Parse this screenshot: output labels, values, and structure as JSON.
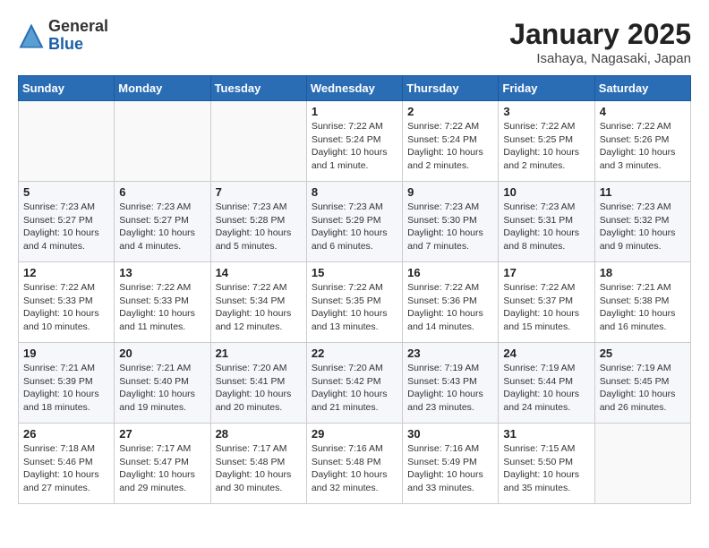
{
  "header": {
    "logo_general": "General",
    "logo_blue": "Blue",
    "month_title": "January 2025",
    "location": "Isahaya, Nagasaki, Japan"
  },
  "weekdays": [
    "Sunday",
    "Monday",
    "Tuesday",
    "Wednesday",
    "Thursday",
    "Friday",
    "Saturday"
  ],
  "weeks": [
    [
      {
        "day": "",
        "info": ""
      },
      {
        "day": "",
        "info": ""
      },
      {
        "day": "",
        "info": ""
      },
      {
        "day": "1",
        "info": "Sunrise: 7:22 AM\nSunset: 5:24 PM\nDaylight: 10 hours\nand 1 minute."
      },
      {
        "day": "2",
        "info": "Sunrise: 7:22 AM\nSunset: 5:24 PM\nDaylight: 10 hours\nand 2 minutes."
      },
      {
        "day": "3",
        "info": "Sunrise: 7:22 AM\nSunset: 5:25 PM\nDaylight: 10 hours\nand 2 minutes."
      },
      {
        "day": "4",
        "info": "Sunrise: 7:22 AM\nSunset: 5:26 PM\nDaylight: 10 hours\nand 3 minutes."
      }
    ],
    [
      {
        "day": "5",
        "info": "Sunrise: 7:23 AM\nSunset: 5:27 PM\nDaylight: 10 hours\nand 4 minutes."
      },
      {
        "day": "6",
        "info": "Sunrise: 7:23 AM\nSunset: 5:27 PM\nDaylight: 10 hours\nand 4 minutes."
      },
      {
        "day": "7",
        "info": "Sunrise: 7:23 AM\nSunset: 5:28 PM\nDaylight: 10 hours\nand 5 minutes."
      },
      {
        "day": "8",
        "info": "Sunrise: 7:23 AM\nSunset: 5:29 PM\nDaylight: 10 hours\nand 6 minutes."
      },
      {
        "day": "9",
        "info": "Sunrise: 7:23 AM\nSunset: 5:30 PM\nDaylight: 10 hours\nand 7 minutes."
      },
      {
        "day": "10",
        "info": "Sunrise: 7:23 AM\nSunset: 5:31 PM\nDaylight: 10 hours\nand 8 minutes."
      },
      {
        "day": "11",
        "info": "Sunrise: 7:23 AM\nSunset: 5:32 PM\nDaylight: 10 hours\nand 9 minutes."
      }
    ],
    [
      {
        "day": "12",
        "info": "Sunrise: 7:22 AM\nSunset: 5:33 PM\nDaylight: 10 hours\nand 10 minutes."
      },
      {
        "day": "13",
        "info": "Sunrise: 7:22 AM\nSunset: 5:33 PM\nDaylight: 10 hours\nand 11 minutes."
      },
      {
        "day": "14",
        "info": "Sunrise: 7:22 AM\nSunset: 5:34 PM\nDaylight: 10 hours\nand 12 minutes."
      },
      {
        "day": "15",
        "info": "Sunrise: 7:22 AM\nSunset: 5:35 PM\nDaylight: 10 hours\nand 13 minutes."
      },
      {
        "day": "16",
        "info": "Sunrise: 7:22 AM\nSunset: 5:36 PM\nDaylight: 10 hours\nand 14 minutes."
      },
      {
        "day": "17",
        "info": "Sunrise: 7:22 AM\nSunset: 5:37 PM\nDaylight: 10 hours\nand 15 minutes."
      },
      {
        "day": "18",
        "info": "Sunrise: 7:21 AM\nSunset: 5:38 PM\nDaylight: 10 hours\nand 16 minutes."
      }
    ],
    [
      {
        "day": "19",
        "info": "Sunrise: 7:21 AM\nSunset: 5:39 PM\nDaylight: 10 hours\nand 18 minutes."
      },
      {
        "day": "20",
        "info": "Sunrise: 7:21 AM\nSunset: 5:40 PM\nDaylight: 10 hours\nand 19 minutes."
      },
      {
        "day": "21",
        "info": "Sunrise: 7:20 AM\nSunset: 5:41 PM\nDaylight: 10 hours\nand 20 minutes."
      },
      {
        "day": "22",
        "info": "Sunrise: 7:20 AM\nSunset: 5:42 PM\nDaylight: 10 hours\nand 21 minutes."
      },
      {
        "day": "23",
        "info": "Sunrise: 7:19 AM\nSunset: 5:43 PM\nDaylight: 10 hours\nand 23 minutes."
      },
      {
        "day": "24",
        "info": "Sunrise: 7:19 AM\nSunset: 5:44 PM\nDaylight: 10 hours\nand 24 minutes."
      },
      {
        "day": "25",
        "info": "Sunrise: 7:19 AM\nSunset: 5:45 PM\nDaylight: 10 hours\nand 26 minutes."
      }
    ],
    [
      {
        "day": "26",
        "info": "Sunrise: 7:18 AM\nSunset: 5:46 PM\nDaylight: 10 hours\nand 27 minutes."
      },
      {
        "day": "27",
        "info": "Sunrise: 7:17 AM\nSunset: 5:47 PM\nDaylight: 10 hours\nand 29 minutes."
      },
      {
        "day": "28",
        "info": "Sunrise: 7:17 AM\nSunset: 5:48 PM\nDaylight: 10 hours\nand 30 minutes."
      },
      {
        "day": "29",
        "info": "Sunrise: 7:16 AM\nSunset: 5:48 PM\nDaylight: 10 hours\nand 32 minutes."
      },
      {
        "day": "30",
        "info": "Sunrise: 7:16 AM\nSunset: 5:49 PM\nDaylight: 10 hours\nand 33 minutes."
      },
      {
        "day": "31",
        "info": "Sunrise: 7:15 AM\nSunset: 5:50 PM\nDaylight: 10 hours\nand 35 minutes."
      },
      {
        "day": "",
        "info": ""
      }
    ]
  ]
}
